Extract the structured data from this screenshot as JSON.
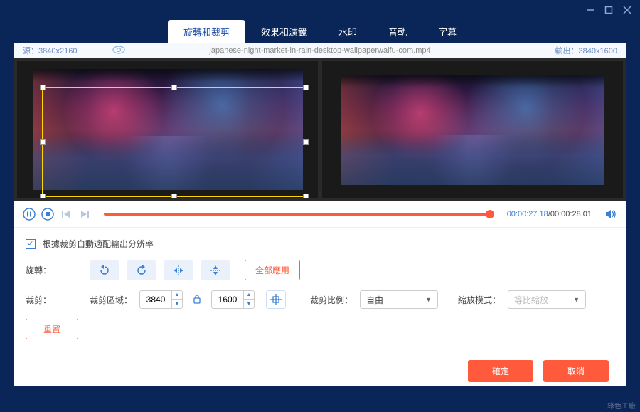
{
  "window": {
    "minimize": "—",
    "maximize": "□",
    "close": "✕"
  },
  "tabs": {
    "rotate_crop": "旋轉和裁剪",
    "effects": "效果和濾鏡",
    "watermark": "水印",
    "audio": "音軌",
    "subtitle": "字幕"
  },
  "info": {
    "source_label": "源：",
    "source_res": "3840x2160",
    "filename": "japanese-night-market-in-rain-desktop-wallpaperwaifu-com.mp4",
    "output_label": "輸出：",
    "output_res": "3840x1600"
  },
  "player": {
    "current": "00:00:27.18",
    "total": "00:00:28.01"
  },
  "form": {
    "auto_fit": "根據裁剪自動適配輸出分辨率",
    "rotate_label": "旋轉：",
    "apply_all": "全部應用",
    "crop_label": "裁剪：",
    "crop_area_label": "裁剪區域：",
    "crop_w": "3840",
    "crop_h": "1600",
    "crop_ratio_label": "裁剪比例：",
    "crop_ratio_value": "自由",
    "zoom_mode_label": "縮放模式：",
    "zoom_mode_value": "等比縮放",
    "reset": "重置"
  },
  "footer": {
    "ok": "確定",
    "cancel": "取消"
  },
  "watermark": "綠色工廠"
}
